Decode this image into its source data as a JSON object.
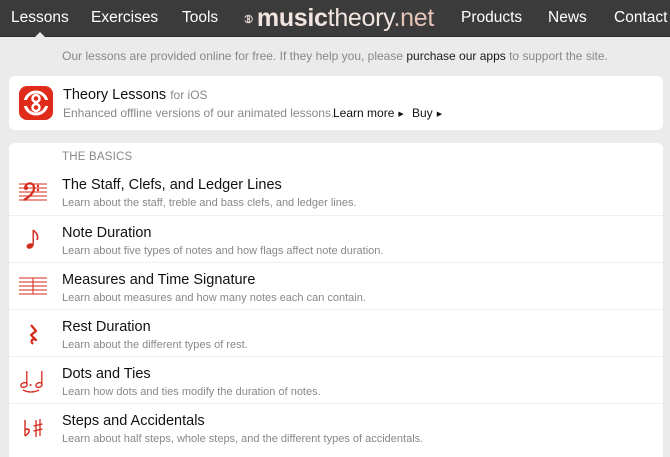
{
  "nav": {
    "lessons": "Lessons",
    "exercises": "Exercises",
    "tools": "Tools",
    "products": "Products",
    "news": "News",
    "contact": "Contact"
  },
  "logo": {
    "part1": "music",
    "part2": "theory",
    "part3": ".net"
  },
  "notice": {
    "before": "Our lessons are provided online for free. If they help you, please ",
    "link": "purchase our apps",
    "after": " to support the site."
  },
  "ios": {
    "title": "Theory Lessons",
    "platform": "for iOS",
    "subtitle": "Enhanced offline versions of our animated lessons.",
    "learn_more": "Learn more",
    "buy": "Buy"
  },
  "section": "THE BASICS",
  "lessons": [
    {
      "title": "The Staff, Clefs, and Ledger Lines",
      "desc": "Learn about the staff, treble and bass clefs, and ledger lines.",
      "icon": "bass-clef-staff-icon"
    },
    {
      "title": "Note Duration",
      "desc": "Learn about five types of notes and how flags affect note duration.",
      "icon": "eighth-note-icon"
    },
    {
      "title": "Measures and Time Signature",
      "desc": "Learn about measures and how many notes each can contain.",
      "icon": "measure-staff-icon"
    },
    {
      "title": "Rest Duration",
      "desc": "Learn about the different types of rest.",
      "icon": "quarter-rest-icon"
    },
    {
      "title": "Dots and Ties",
      "desc": "Learn how dots and ties modify the duration of notes.",
      "icon": "tied-notes-icon"
    },
    {
      "title": "Steps and Accidentals",
      "desc": "Learn about half steps, whole steps, and the different types of accidentals.",
      "icon": "flat-sharp-icon"
    }
  ],
  "colors": {
    "accent": "#d42a1c",
    "nav_bg": "#3b3b3b",
    "page_bg": "#ecebeb"
  }
}
